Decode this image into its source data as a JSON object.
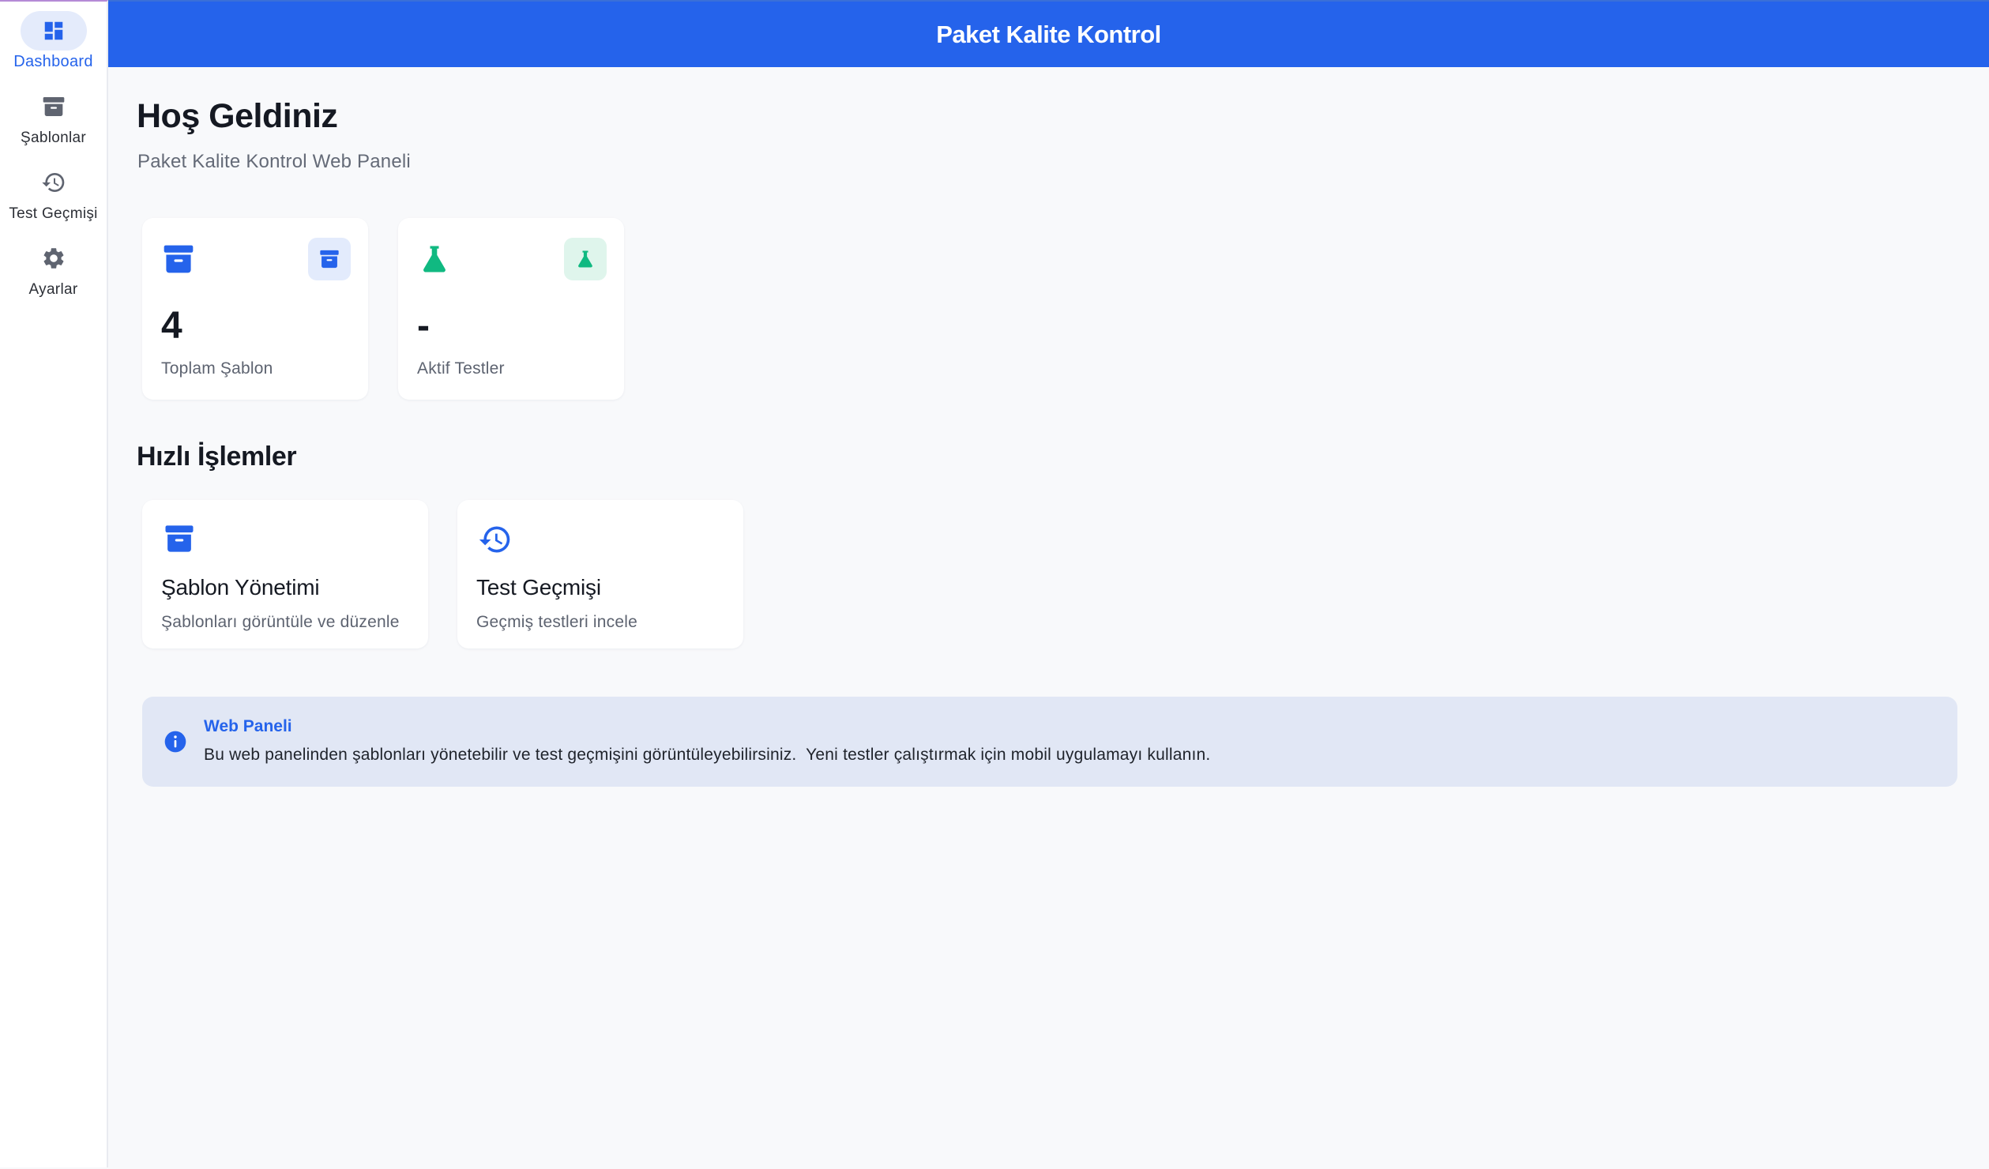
{
  "app": {
    "title": "Paket Kalite Kontrol",
    "accent_color": "#2563eb",
    "success_color": "#10b981"
  },
  "nav": {
    "items": [
      {
        "label": "Dashboard",
        "icon": "dashboard-icon",
        "active": true
      },
      {
        "label": "Şablonlar",
        "icon": "archive-box-icon",
        "active": false
      },
      {
        "label": "Test Geçmişi",
        "icon": "history-icon",
        "active": false
      },
      {
        "label": "Ayarlar",
        "icon": "gear-icon",
        "active": false
      }
    ]
  },
  "welcome": {
    "title": "Hoş Geldiniz",
    "subtitle": "Paket Kalite Kontrol Web Paneli"
  },
  "stats": [
    {
      "value": "4",
      "label": "Toplam Şablon",
      "icon": "archive-box-icon"
    },
    {
      "value": "-",
      "label": "Aktif Testler",
      "icon": "flask-icon"
    }
  ],
  "quick_actions": {
    "title": "Hızlı İşlemler",
    "items": [
      {
        "title": "Şablon Yönetimi",
        "description": "Şablonları görüntüle ve düzenle",
        "icon": "archive-box-icon"
      },
      {
        "title": "Test Geçmişi",
        "description": "Geçmiş testleri incele",
        "icon": "history-icon"
      }
    ]
  },
  "info_banner": {
    "title": "Web Paneli",
    "text": "Bu web panelinden şablonları yönetebilir ve test geçmişini görüntüleyebilirsiniz.  Yeni testler çalıştırmak için mobil uygulamayı kullanın.",
    "icon": "info-icon"
  }
}
